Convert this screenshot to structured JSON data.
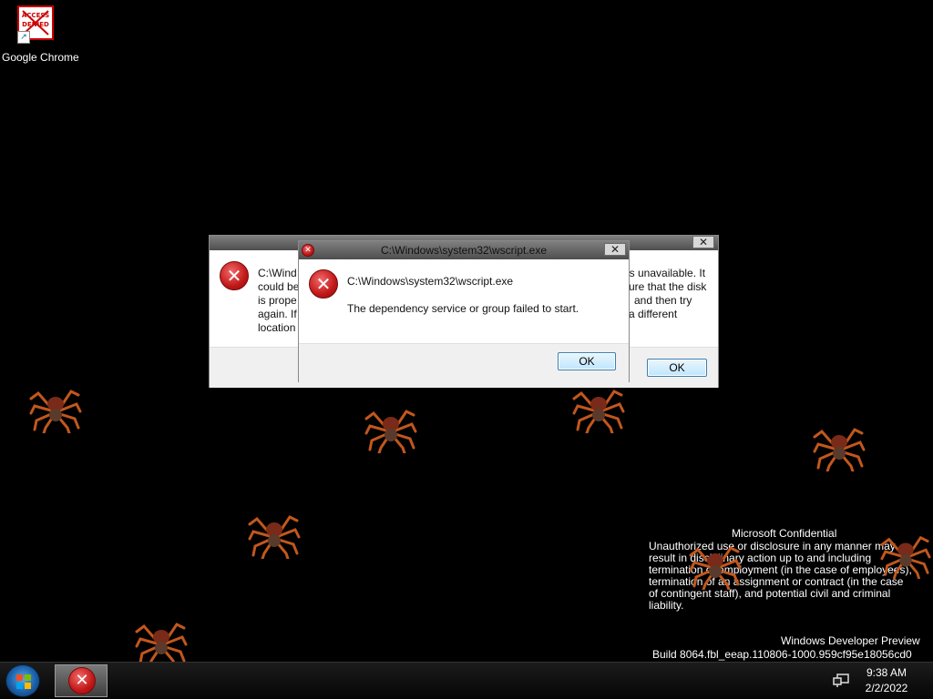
{
  "desktop": {
    "icon": {
      "label": "Google Chrome",
      "image_text": "ACCESS DENIED"
    }
  },
  "back_dialog": {
    "close_glyph": "✕",
    "lines": [
      "C:\\Wind",
      "could be",
      "is prope",
      "again. If",
      "location"
    ],
    "right_lines": [
      "is unavailable. It",
      "ure that the disk",
      "and then try",
      "a different",
      ""
    ],
    "ok_label": "OK"
  },
  "front_dialog": {
    "title": "C:\\Windows\\system32\\wscript.exe",
    "close_glyph": "✕",
    "heading": "C:\\Windows\\system32\\wscript.exe",
    "message": "The dependency service or group failed to start.",
    "ok_label": "OK"
  },
  "watermark": {
    "title": "Microsoft Confidential",
    "lines": [
      "Unauthorized use or disclosure in any manner may",
      "result in disciplinary action up to and including",
      "termination of employment (in the case of employees),",
      "termination of an assignment or contract (in the case",
      "of contingent staff), and potential civil and criminal",
      "liability."
    ],
    "build_title": "Windows Developer Preview",
    "build": "Build 8064.fbl_eeap.110806-1000.959cf95e18056cd0"
  },
  "taskbar": {
    "time": "9:38 AM",
    "date": "2/2/2022"
  },
  "colors": {
    "desktop_bg": "#000000",
    "error_red": "#c01818",
    "button_blue": "#3c7fb1"
  }
}
